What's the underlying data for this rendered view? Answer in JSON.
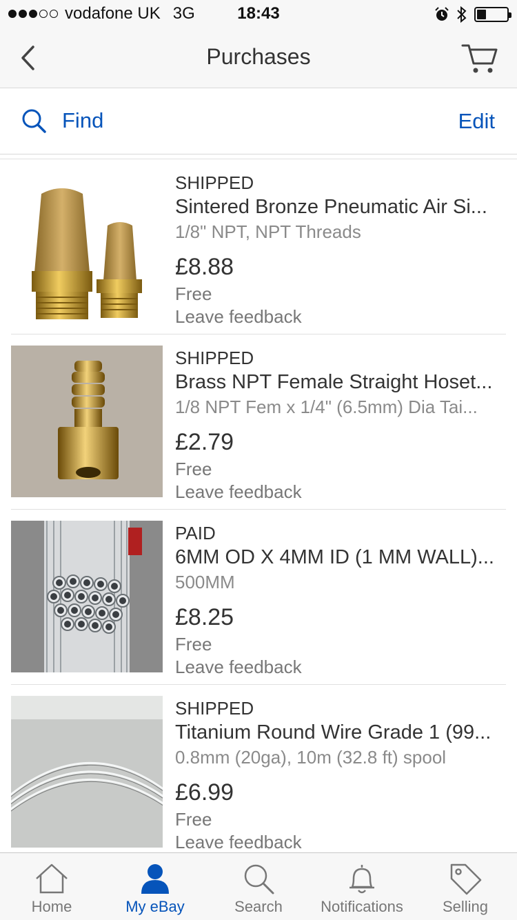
{
  "status_bar": {
    "carrier": "vodafone UK",
    "network": "3G",
    "time": "18:43",
    "signal_bars": 3,
    "signal_total": 5,
    "battery_level": 0.3
  },
  "nav": {
    "title": "Purchases",
    "back_icon": "chevron-left-icon",
    "cart_icon": "cart-icon"
  },
  "toolbar": {
    "find_label": "Find",
    "edit_label": "Edit"
  },
  "colors": {
    "accent": "#0654ba"
  },
  "purchases": [
    {
      "status": "SHIPPED",
      "title": "Sintered Bronze Pneumatic Air Si...",
      "variant": "1/8\" NPT, NPT Threads",
      "price": "£8.88",
      "shipping": "Free",
      "action": "Leave feedback"
    },
    {
      "status": "SHIPPED",
      "title": "Brass NPT Female Straight Hoset...",
      "variant": "1/8 NPT Fem x 1/4\" (6.5mm) Dia  Tai...",
      "price": "£2.79",
      "shipping": "Free",
      "action": "Leave feedback"
    },
    {
      "status": "PAID",
      "title": "6MM OD X 4MM ID (1 MM WALL)...",
      "variant": "500MM",
      "price": "£8.25",
      "shipping": "Free",
      "action": "Leave feedback"
    },
    {
      "status": "SHIPPED",
      "title": "Titanium Round Wire Grade 1 (99...",
      "variant": "0.8mm (20ga), 10m (32.8 ft) spool",
      "price": "£6.99",
      "shipping": "Free",
      "action": "Leave feedback"
    }
  ],
  "tabs": [
    {
      "label": "Home",
      "icon": "home-icon",
      "active": false
    },
    {
      "label": "My eBay",
      "icon": "person-icon",
      "active": true
    },
    {
      "label": "Search",
      "icon": "search-icon",
      "active": false
    },
    {
      "label": "Notifications",
      "icon": "bell-icon",
      "active": false
    },
    {
      "label": "Selling",
      "icon": "tag-icon",
      "active": false
    }
  ]
}
